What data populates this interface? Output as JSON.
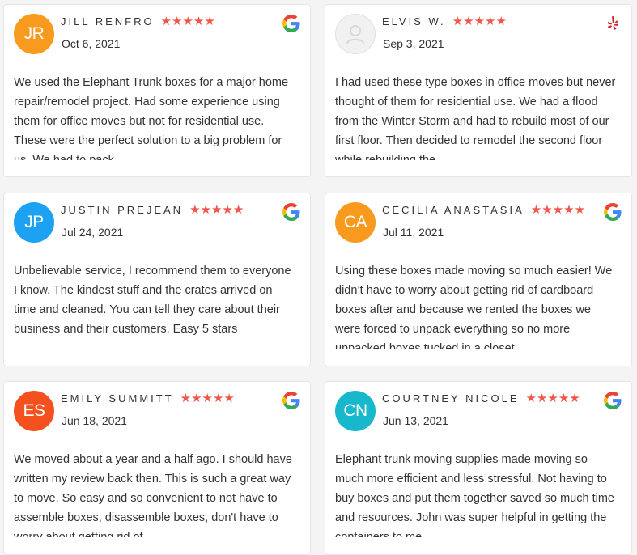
{
  "reviews": [
    {
      "initials": "JR",
      "avatar_color": "#f79a1d",
      "name": "JILL RENFRO",
      "rating_stars": "★★★★★",
      "rating": 5,
      "date": "Oct 6, 2021",
      "source_icon": "google-icon",
      "text": "We used the Elephant Trunk boxes for a major home repair/remodel project. Had some experience using them for office moves but not for residential use. These were the perfect solution to a big problem for us. We had to pack"
    },
    {
      "initials": "",
      "avatar_color": "#f1f1f1",
      "name": "ELVIS W.",
      "rating_stars": "★★★★★",
      "rating": 5,
      "date": "Sep 3, 2021",
      "source_icon": "yelp-icon",
      "text": "I had used these type boxes in office moves but never thought of them for residential use.  We had a flood from the Winter Storm and had to rebuild most of our first floor.  Then decided to remodel the second floor while rebuilding the"
    },
    {
      "initials": "JP",
      "avatar_color": "#1da1f2",
      "name": "JUSTIN PREJEAN",
      "rating_stars": "★★★★★",
      "rating": 5,
      "date": "Jul 24, 2021",
      "source_icon": "google-icon",
      "text": "Unbelievable service, I recommend them to everyone I know. The kindest stuff and the crates arrived on time and cleaned. You can tell they care about their business and their customers. Easy 5 stars"
    },
    {
      "initials": "CA",
      "avatar_color": "#f79a1d",
      "name": "CECILIA ANASTASIA",
      "rating_stars": "★★★★★",
      "rating": 5,
      "date": "Jul 11, 2021",
      "source_icon": "google-icon",
      "text": "Using these boxes made moving so much easier! We didn’t have to worry about getting rid of cardboard boxes after and because we rented the boxes we were forced to unpack everything so no more unpacked boxes tucked in a closet."
    },
    {
      "initials": "ES",
      "avatar_color": "#f4511e",
      "name": "EMILY SUMMITT",
      "rating_stars": "★★★★★",
      "rating": 5,
      "date": "Jun 18, 2021",
      "source_icon": "google-icon",
      "text": "We moved about a year and a half ago. I should have written my review back then. This is such a great way to move. So easy and so convenient to not have to assemble boxes, disassemble boxes, don't have to worry about getting rid of"
    },
    {
      "initials": "CN",
      "avatar_color": "#17b8cc",
      "name": "COURTNEY NICOLE",
      "rating_stars": "★★★★★",
      "rating": 5,
      "date": "Jun 13, 2021",
      "source_icon": "google-icon",
      "text": "Elephant trunk moving supplies made moving so much more efficient and less stressful. Not having to buy boxes and put them together saved so much time and resources. John was super helpful in getting the containers to me"
    }
  ]
}
